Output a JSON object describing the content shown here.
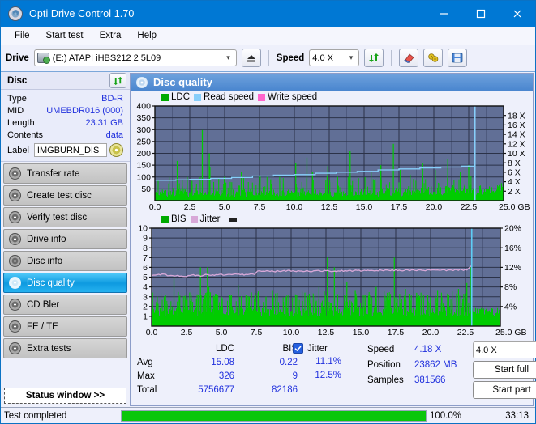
{
  "window": {
    "title": "Opti Drive Control 1.70",
    "icon": "disc-icon",
    "minimize": "–",
    "maximize": "□",
    "close": "✕"
  },
  "menu": {
    "items": [
      "File",
      "Start test",
      "Extra",
      "Help"
    ]
  },
  "toolbar": {
    "drive_label": "Drive",
    "drive_value": "(E:)   ATAPI iHBS212   2 5L09",
    "eject_icon": "eject-icon",
    "speed_label": "Speed",
    "speed_value": "4.0 X",
    "refresh_icon": "refresh-icon",
    "erase_icon": "eraser-icon",
    "tools_icon": "tools-icon",
    "save_icon": "save-icon"
  },
  "disc": {
    "header": "Disc",
    "refresh_icon": "refresh-icon",
    "rows": [
      {
        "key": "Type",
        "value": "BD-R"
      },
      {
        "key": "MID",
        "value": "UMEBDR016 (000)"
      },
      {
        "key": "Length",
        "value": "23.31 GB"
      },
      {
        "key": "Contents",
        "value": "data"
      }
    ],
    "label_key": "Label",
    "label_value": "IMGBURN_DIS",
    "disc_icon": "disc-icon"
  },
  "sidebar": {
    "items": [
      {
        "label": "Transfer rate",
        "active": false
      },
      {
        "label": "Create test disc",
        "active": false
      },
      {
        "label": "Verify test disc",
        "active": false
      },
      {
        "label": "Drive info",
        "active": false
      },
      {
        "label": "Disc info",
        "active": false
      },
      {
        "label": "Disc quality",
        "active": true
      },
      {
        "label": "CD Bler",
        "active": false
      },
      {
        "label": "FE / TE",
        "active": false
      },
      {
        "label": "Extra tests",
        "active": false
      }
    ],
    "status_window": "Status window >>"
  },
  "panel": {
    "title": "Disc quality",
    "icon": "disc-quality-icon"
  },
  "stats": {
    "col_headers": [
      "LDC",
      "BIS"
    ],
    "rows": [
      {
        "key": "Avg",
        "ldc": "15.08",
        "bis": "0.22"
      },
      {
        "key": "Max",
        "ldc": "326",
        "bis": "9"
      },
      {
        "key": "Total",
        "ldc": "5756677",
        "bis": "82186"
      }
    ],
    "jitter_label": "Jitter",
    "jitter_checked": true,
    "jitter_avg": "11.1%",
    "jitter_max": "12.5%",
    "speed_key": "Speed",
    "speed_value": "4.18 X",
    "position_key": "Position",
    "position_value": "23862 MB",
    "samples_key": "Samples",
    "samples_value": "381566",
    "speed_select": "4.0 X",
    "start_full": "Start full",
    "start_part": "Start part"
  },
  "statusbar": {
    "text": "Test completed",
    "percent": "100.0%",
    "progress": 100,
    "time": "33:13"
  },
  "colors": {
    "accent": "#0078d4",
    "ldc_green": "#00cc00",
    "read_speed": "#87cefa",
    "write_speed": "#ff66cc",
    "jitter": "#d8a8d8",
    "plot_bg": "#616f96",
    "grid": "#2b3248",
    "value_blue": "#2030dd"
  },
  "chart_data": [
    {
      "type": "area",
      "title": "LDC / Read speed",
      "legend": [
        {
          "label": "LDC",
          "color": "#00aa00"
        },
        {
          "label": "Read speed",
          "color": "#87cefa"
        },
        {
          "label": "Write speed",
          "color": "#ff66cc"
        }
      ],
      "xlabel": "GB",
      "x_ticks": [
        "0.0",
        "2.5",
        "5.0",
        "7.5",
        "10.0",
        "12.5",
        "15.0",
        "17.5",
        "20.0",
        "22.5",
        "25.0 GB"
      ],
      "xlim": [
        0,
        25
      ],
      "ylabel_left": "LDC",
      "y_ticks_left": [
        "400",
        "350",
        "300",
        "250",
        "200",
        "150",
        "100",
        "50"
      ],
      "ylim_left": [
        0,
        400
      ],
      "ylabel_right": "Speed",
      "y_ticks_right": [
        "18 X",
        "16 X",
        "14 X",
        "12 X",
        "10 X",
        "8 X",
        "6 X",
        "4 X",
        "2 X"
      ],
      "ylim_right": [
        0,
        20
      ],
      "grid": true,
      "series": [
        {
          "name": "LDC",
          "color": "#00cc00",
          "render": "spiky-area",
          "baseline": [
            26,
            30,
            28,
            34,
            30,
            27,
            33,
            29,
            36,
            31,
            28,
            34,
            30,
            35,
            29,
            32,
            30,
            34,
            28,
            31,
            35,
            29,
            33,
            30,
            28,
            36,
            31,
            29,
            34,
            30,
            32,
            28,
            35,
            30,
            33,
            29,
            31,
            36,
            30,
            28,
            34,
            31,
            29,
            35,
            30,
            33,
            31,
            28,
            34,
            30,
            36,
            31,
            29,
            33,
            35,
            30,
            32,
            28,
            34,
            31,
            36,
            30,
            33,
            29,
            35,
            31,
            37,
            32,
            30,
            36,
            33,
            31,
            38,
            34,
            32,
            37,
            35,
            31,
            39,
            34,
            36,
            32,
            38,
            35,
            33,
            40,
            36,
            34,
            39,
            37,
            35,
            41,
            38,
            36,
            42,
            39,
            37,
            43,
            40,
            38,
            44,
            41,
            39,
            45,
            42,
            40,
            46,
            43,
            41,
            47,
            44,
            42,
            48,
            45,
            43,
            49,
            46,
            44,
            50,
            47,
            45,
            51,
            48,
            46,
            52,
            49,
            47,
            53
          ],
          "spikes": [
            [
              1.6,
              168
            ],
            [
              3.4,
              298
            ],
            [
              3.9,
              200
            ],
            [
              3.95,
              140
            ],
            [
              6.2,
              120
            ],
            [
              8.3,
              90
            ],
            [
              10.1,
              160
            ],
            [
              10.9,
              182
            ],
            [
              11.3,
              120
            ],
            [
              12.4,
              146
            ],
            [
              13.1,
              100
            ],
            [
              14.0,
              210
            ],
            [
              14.6,
              95
            ],
            [
              15.5,
              120
            ],
            [
              16.2,
              150
            ],
            [
              17.1,
              240
            ],
            [
              17.6,
              130
            ],
            [
              18.3,
              110
            ],
            [
              19.2,
              160
            ],
            [
              20.1,
              130
            ],
            [
              21.0,
              175
            ],
            [
              21.9,
              120
            ],
            [
              22.5,
              150
            ],
            [
              22.9,
              210
            ]
          ]
        },
        {
          "name": "Read speed",
          "color": "#87cefa",
          "render": "step-line",
          "points": [
            [
              0.0,
              4.3
            ],
            [
              1.5,
              4.4
            ],
            [
              2.5,
              4.5
            ],
            [
              4.0,
              4.7
            ],
            [
              5.5,
              4.9
            ],
            [
              7.0,
              5.2
            ],
            [
              8.5,
              5.4
            ],
            [
              10.0,
              5.5
            ],
            [
              11.5,
              5.8
            ],
            [
              13.0,
              6.0
            ],
            [
              14.5,
              6.2
            ],
            [
              16.0,
              6.5
            ],
            [
              17.5,
              6.7
            ],
            [
              19.0,
              6.9
            ],
            [
              20.5,
              7.1
            ],
            [
              22.0,
              7.3
            ],
            [
              22.9,
              7.4
            ]
          ],
          "end_spike_x": 22.95
        }
      ]
    },
    {
      "type": "area",
      "title": "BIS / Jitter",
      "legend": [
        {
          "label": "BIS",
          "color": "#00aa00"
        },
        {
          "label": "Jitter",
          "color": "#d8a8d8"
        }
      ],
      "xlabel": "GB",
      "x_ticks": [
        "0.0",
        "2.5",
        "5.0",
        "7.5",
        "10.0",
        "12.5",
        "15.0",
        "17.5",
        "20.0",
        "22.5",
        "25.0 GB"
      ],
      "xlim": [
        0,
        25
      ],
      "ylabel_left": "BIS",
      "y_ticks_left": [
        "10",
        "9",
        "8",
        "7",
        "6",
        "5",
        "4",
        "3",
        "2",
        "1"
      ],
      "ylim_left": [
        0,
        10
      ],
      "ylabel_right": "Jitter",
      "y_ticks_right": [
        "20%",
        "16%",
        "12%",
        "8%",
        "4%"
      ],
      "ylim_right": [
        0,
        20
      ],
      "grid": true,
      "series": [
        {
          "name": "BIS",
          "color": "#00cc00",
          "render": "spiky-area",
          "baseline_low": 1.0,
          "baseline_high": 2.0,
          "spikes": [
            [
              0.4,
              3.0
            ],
            [
              0.9,
              3.0
            ],
            [
              1.6,
              5.0
            ],
            [
              2.0,
              3.0
            ],
            [
              2.4,
              3.1
            ],
            [
              3.5,
              6.0
            ],
            [
              4.0,
              6.0
            ],
            [
              4.1,
              4.0
            ],
            [
              5.0,
              3.0
            ],
            [
              5.6,
              3.2
            ],
            [
              6.2,
              4.2
            ],
            [
              7.0,
              3.0
            ],
            [
              7.4,
              3.1
            ],
            [
              8.2,
              3.0
            ],
            [
              9.0,
              3.4
            ],
            [
              9.6,
              3.0
            ],
            [
              10.4,
              3.2
            ],
            [
              11.2,
              3.1
            ],
            [
              12.0,
              4.0
            ],
            [
              12.6,
              7.0
            ],
            [
              13.1,
              6.0
            ],
            [
              14.0,
              4.5
            ],
            [
              14.6,
              3.6
            ],
            [
              15.3,
              3.2
            ],
            [
              16.1,
              4.0
            ],
            [
              16.9,
              3.4
            ],
            [
              17.4,
              7.0
            ],
            [
              18.2,
              3.8
            ],
            [
              19.0,
              3.4
            ],
            [
              19.8,
              3.2
            ],
            [
              20.5,
              3.6
            ],
            [
              21.3,
              3.2
            ],
            [
              22.0,
              3.8
            ],
            [
              22.6,
              4.4
            ],
            [
              22.9,
              6.0
            ]
          ]
        },
        {
          "name": "Jitter",
          "color": "#d8a8d8",
          "render": "line",
          "points": [
            [
              0.0,
              10.3
            ],
            [
              0.5,
              10.6
            ],
            [
              1.0,
              10.5
            ],
            [
              1.5,
              10.2
            ],
            [
              2.0,
              10.3
            ],
            [
              2.5,
              10.2
            ],
            [
              3.0,
              10.4
            ],
            [
              3.5,
              10.3
            ],
            [
              4.0,
              10.5
            ],
            [
              4.5,
              10.4
            ],
            [
              5.0,
              10.5
            ],
            [
              5.5,
              10.5
            ],
            [
              6.0,
              10.6
            ],
            [
              6.5,
              10.5
            ],
            [
              7.0,
              10.6
            ],
            [
              7.4,
              10.6
            ],
            [
              7.6,
              11.2
            ],
            [
              8.0,
              11.2
            ],
            [
              9.0,
              11.2
            ],
            [
              10.0,
              11.3
            ],
            [
              11.0,
              11.2
            ],
            [
              12.0,
              11.3
            ],
            [
              13.0,
              11.2
            ],
            [
              14.0,
              11.3
            ],
            [
              15.0,
              11.3
            ],
            [
              16.0,
              11.3
            ],
            [
              17.0,
              11.4
            ],
            [
              18.0,
              11.4
            ],
            [
              19.0,
              11.4
            ],
            [
              20.0,
              11.4
            ],
            [
              21.0,
              11.4
            ],
            [
              22.0,
              11.5
            ],
            [
              22.6,
              11.5
            ],
            [
              22.9,
              12.4
            ]
          ]
        }
      ]
    }
  ]
}
